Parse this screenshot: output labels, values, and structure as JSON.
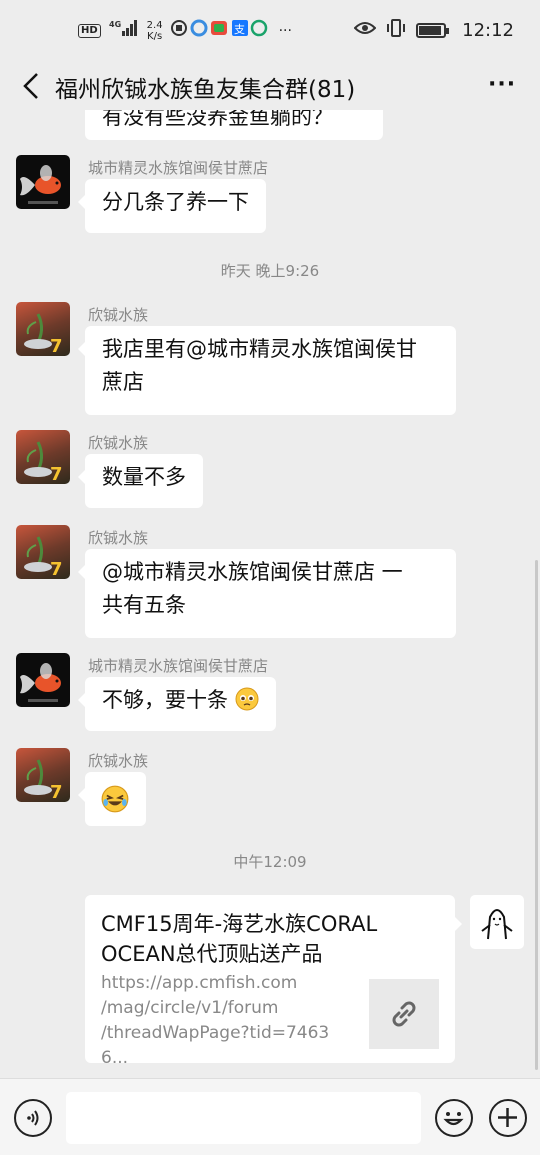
{
  "status_bar": {
    "hd": "HD",
    "net": "4G",
    "speed_value": "2.4",
    "speed_unit": "K/s",
    "time": "12:12"
  },
  "header": {
    "title": "福州欣铖水族鱼友集合群(81)",
    "more": "···"
  },
  "chat": {
    "partial_message": "有没有些没养金鱼躺的？",
    "messages": [
      {
        "sender": "城市精灵水族馆闽侯甘蔗店",
        "text": "分几条了养一下"
      },
      {
        "sender": "欣铖水族",
        "text_line1": "我店里有@城市精灵水族馆闽侯甘",
        "text_line2": "蔗店"
      },
      {
        "sender": "欣铖水族",
        "text": "数量不多"
      },
      {
        "sender": "欣铖水族",
        "text_line1": "@城市精灵水族馆闽侯甘蔗店  一",
        "text_line2": "共有五条"
      },
      {
        "sender": "城市精灵水族馆闽侯甘蔗店",
        "text": "不够，要十条"
      },
      {
        "sender": "欣铖水族",
        "icon": "laughing-crying-emoji"
      }
    ],
    "timestamps": [
      "昨天 晚上9:26",
      "中午12:09"
    ],
    "link_card": {
      "title_line1": "CMF15周年-海艺水族CORAL",
      "title_line2": "OCEAN总代顶贴送产品",
      "url_line1": "https://app.cmfish.com",
      "url_line2": "/mag/circle/v1/forum",
      "url_line3": "/threadWapPage?tid=74636..."
    }
  },
  "input_bar": {
    "placeholder": ""
  },
  "colors": {
    "background": "#ededed",
    "bubble": "#ffffff",
    "meta_text": "#888888"
  }
}
